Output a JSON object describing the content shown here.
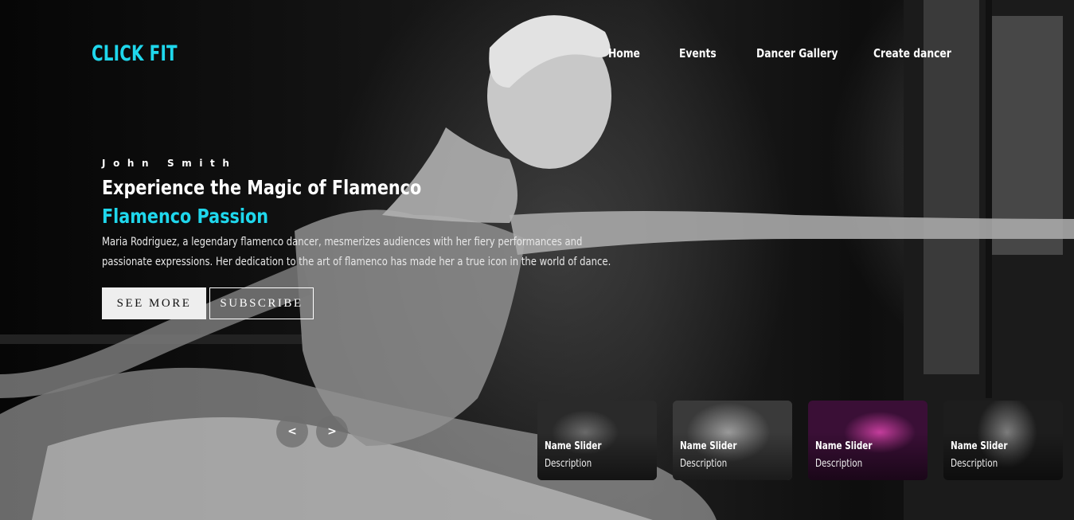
{
  "brand": {
    "logo_text": "CLICK FIT",
    "accent_color": "#1fd7ec"
  },
  "nav": {
    "items": [
      {
        "label": "Home"
      },
      {
        "label": "Events"
      },
      {
        "label": "Dancer Gallery"
      },
      {
        "label": "Create dancer"
      }
    ]
  },
  "hero": {
    "background_image": "black-and-white photo of a ballerina in a tutu, arm extended toward a window",
    "author": "John Smith",
    "title": "Experience the Magic of Flamenco",
    "subtitle": "Flamenco Passion",
    "description": "Maria Rodriguez, a legendary flamenco dancer, mesmerizes audiences with her fiery performances and passionate expressions. Her dedication to the art of flamenco has made her a true icon in the world of dance.",
    "buttons": {
      "see_more": "SEE MORE",
      "subscribe": "SUBSCRIBE"
    }
  },
  "slider": {
    "prev_icon": "chevron-left-icon",
    "next_icon": "chevron-right-icon",
    "prev_glyph": "<",
    "next_glyph": ">",
    "thumbnails": [
      {
        "name": "Name Slider",
        "description": "Description"
      },
      {
        "name": "Name Slider",
        "description": "Description"
      },
      {
        "name": "Name Slider",
        "description": "Description"
      },
      {
        "name": "Name Slider",
        "description": "Description"
      }
    ]
  }
}
